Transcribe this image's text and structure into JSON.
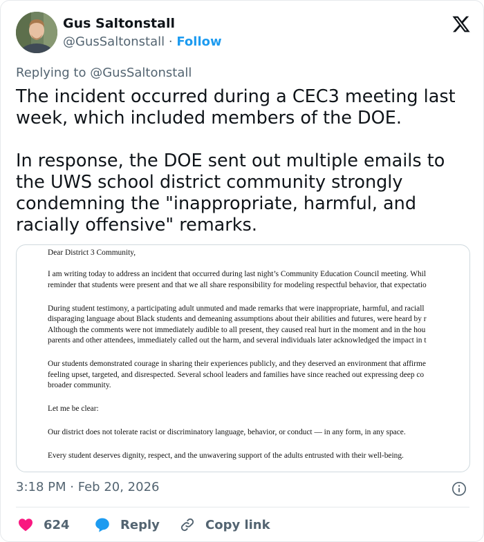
{
  "author": {
    "name": "Gus Saltonstall",
    "handle": "@GusSaltonstall",
    "separator": "·",
    "follow_label": "Follow"
  },
  "platform_icon": "x-logo-icon",
  "reply": {
    "prefix": "Replying to",
    "handle": "@GusSaltonstall"
  },
  "tweet": {
    "paragraph1": "The incident occurred during a CEC3 meeting last week, which included members of the DOE.",
    "paragraph2": "In response, the DOE sent out multiple emails to the UWS school district community strongly condemning the \"inappropriate, harmful, and racially offensive\" remarks."
  },
  "document": {
    "salutation": "Dear District 3 Community,",
    "para1": [
      "I am writing today to address an incident that occurred during last night’s Community Education Council meeting. Whil",
      "reminder that students were present and that we all share responsibility for modeling respectful behavior, that expectatio"
    ],
    "para2": [
      "During student testimony, a participating adult unmuted and made remarks that were inappropriate, harmful, and raciall",
      "disparaging language about Black students and demeaning assumptions about their abilities and futures, were heard by r",
      "Although the comments were not immediately audible to all present, they caused real hurt in the moment and in the hou",
      "parents and other attendees, immediately called out the harm, and several individuals later acknowledged the impact in t"
    ],
    "para3": [
      "Our students demonstrated courage in sharing their experiences publicly, and they deserved an environment that affirme",
      "feeling upset, targeted, and disrespected. Several school leaders and families have since reached out expressing deep co",
      "broader community."
    ],
    "para4": "Let me be clear:",
    "para5": "Our district does not tolerate racist or discriminatory language, behavior, or conduct — in any form, in any space.",
    "para6": "Every student deserves dignity, respect, and the unwavering support of the adults entrusted with their well-being."
  },
  "timestamp": {
    "time": "3:18 PM",
    "separator": "·",
    "date": "Feb 20, 2026"
  },
  "actions": {
    "likes_count": "624",
    "reply_label": "Reply",
    "copy_link_label": "Copy link"
  },
  "colors": {
    "accent": "#1d9bf0",
    "like": "#f91880",
    "muted": "#536471",
    "text": "#0f1419"
  }
}
